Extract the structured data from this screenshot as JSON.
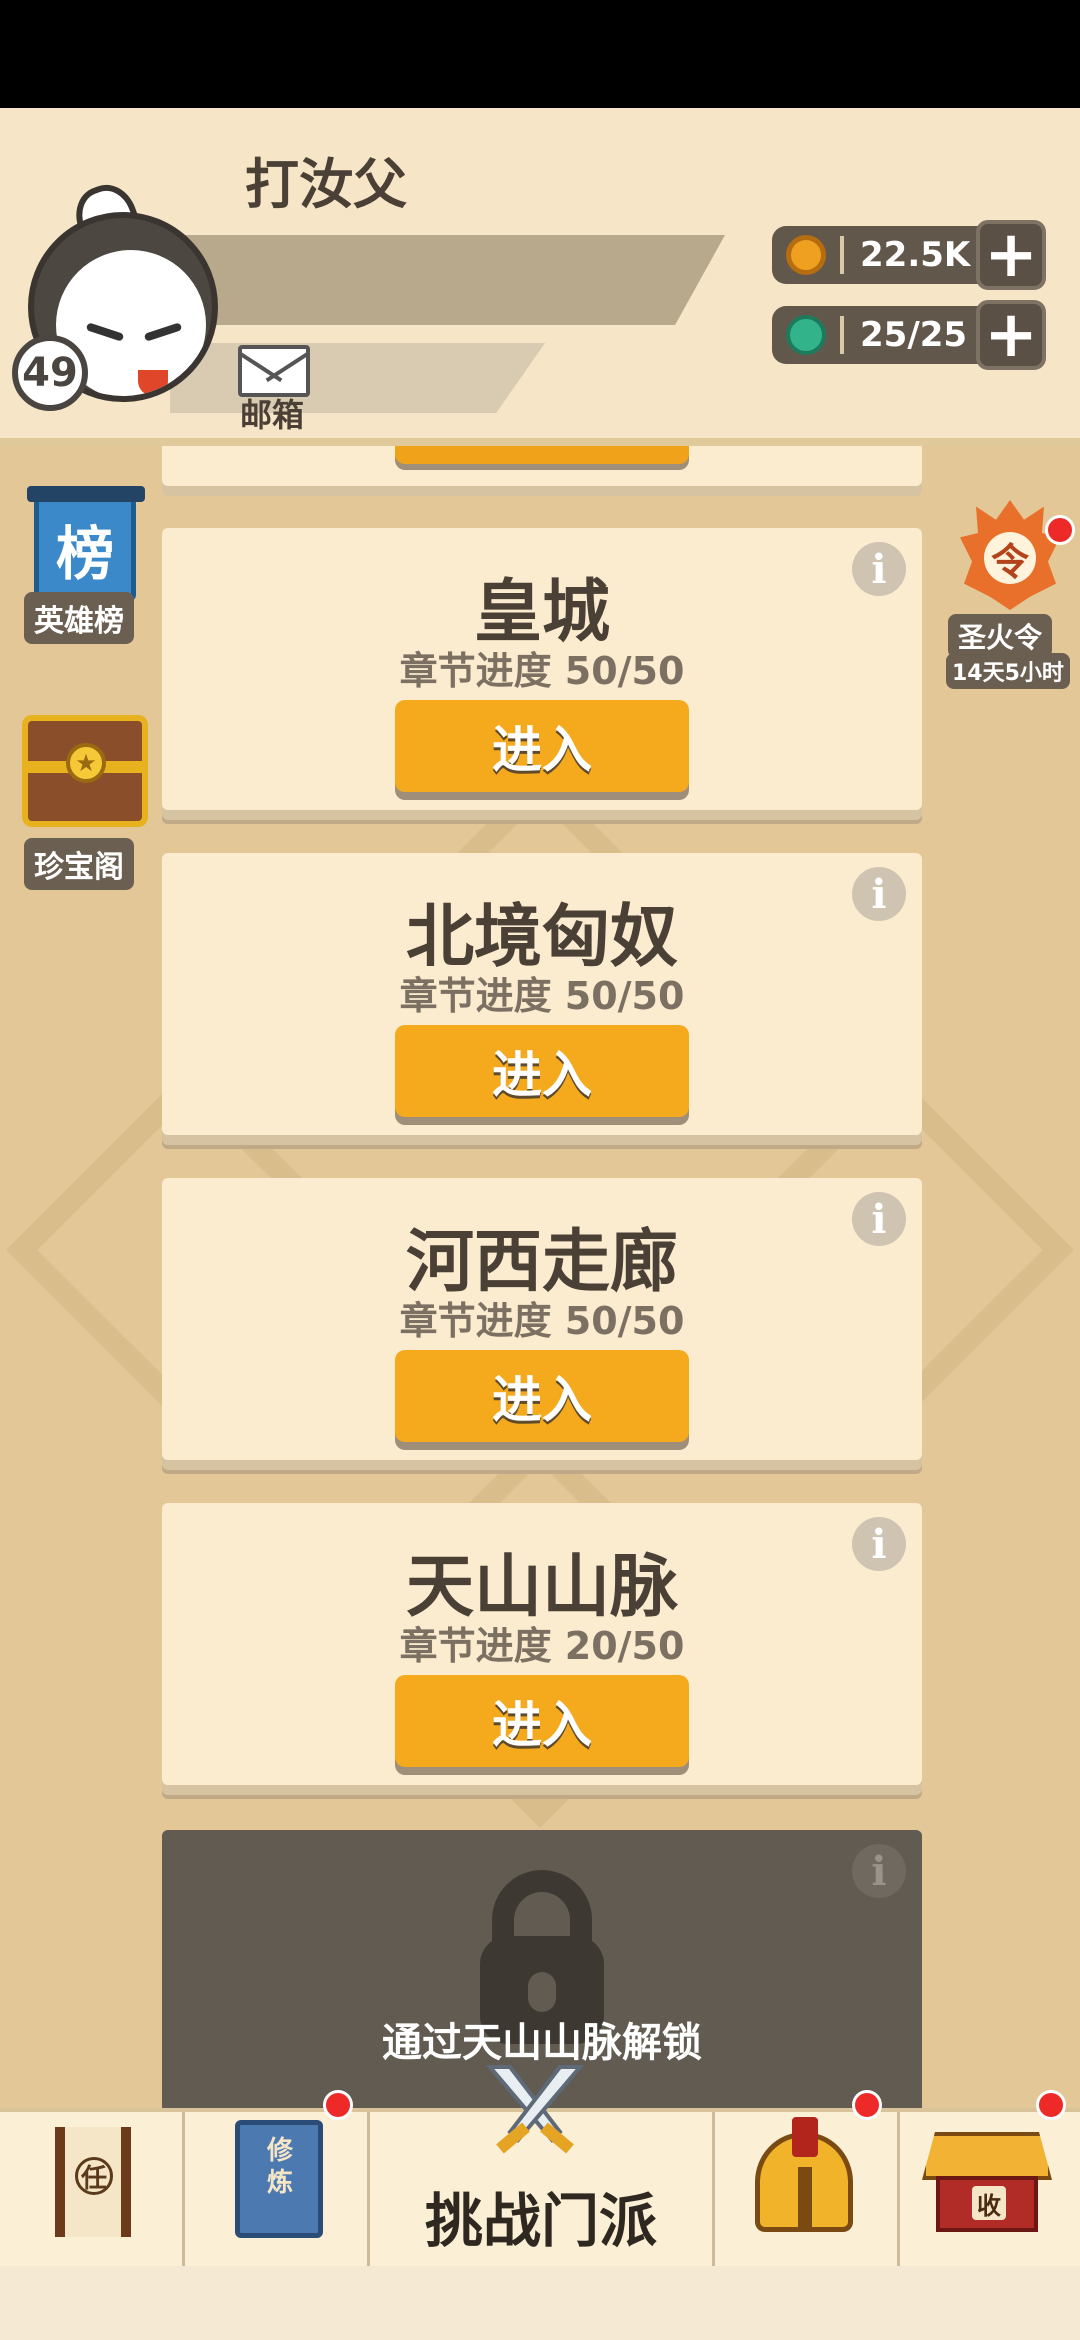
{
  "player": {
    "name": "打汝父",
    "level": "49",
    "mail_label": "邮箱"
  },
  "currencies": [
    {
      "icon": "coin-icon",
      "value": "22.5K",
      "color": "#f0a020"
    },
    {
      "icon": "jade-icon",
      "value": "25/25",
      "color": "#33b38a"
    }
  ],
  "side_left": [
    {
      "icon_text": "榜",
      "label": "英雄榜"
    },
    {
      "label": "珍宝阁"
    }
  ],
  "side_right": {
    "icon_text": "令",
    "label": "圣火令",
    "timer": "14天5小时"
  },
  "levels": [
    {
      "title": "皇城",
      "progress": "章节进度 50/50",
      "button": "进入"
    },
    {
      "title": "北境匈奴",
      "progress": "章节进度 50/50",
      "button": "进入"
    },
    {
      "title": "河西走廊",
      "progress": "章节进度 50/50",
      "button": "进入"
    },
    {
      "title": "天山山脉",
      "progress": "章节进度 20/50",
      "button": "进入"
    }
  ],
  "locked_level": {
    "hint": "通过天山山脉解锁"
  },
  "info_glyph": "i",
  "bottom_nav": {
    "task_icon_text": "任",
    "train_icon_text": "修炼",
    "challenge_label": "挑战门派",
    "shop_icon_text": "收"
  },
  "colors": {
    "accent_button": "#f5a91c",
    "card_bg": "#fbecd0",
    "badge_red": "#ee2a28"
  }
}
